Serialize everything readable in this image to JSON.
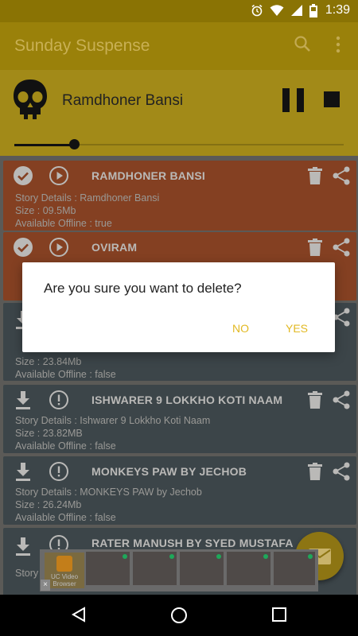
{
  "status_bar": {
    "clock": "1:39",
    "icons": [
      "alarm-icon",
      "wifi-icon",
      "signal-icon",
      "battery-icon"
    ]
  },
  "app_bar": {
    "title": "Sunday Suspense",
    "actions": [
      "search-icon",
      "overflow-menu-icon"
    ]
  },
  "player": {
    "track_title": "Ramdhoner Bansi",
    "progress_fraction": 0.18,
    "controls": [
      "pause-icon",
      "stop-icon"
    ]
  },
  "stories": [
    {
      "title": "RAMDHONER BANSI",
      "details": "Story Details : Ramdhoner Bansi",
      "size": "Size : 09.5Mb",
      "offline": "Available Offline : true",
      "downloaded": true
    },
    {
      "title": "OVIRAM",
      "details": "",
      "size": "",
      "offline": "",
      "downloaded": true
    },
    {
      "title": "",
      "details": "",
      "size": "Size : 23.84Mb",
      "offline": "Available Offline : false",
      "downloaded": false
    },
    {
      "title": "ISHWARER 9 LOKKHO KOTI NAAM",
      "details": "Story Details : Ishwarer 9 Lokkho Koti Naam",
      "size": "Size : 23.82MB",
      "offline": "Available Offline : false",
      "downloaded": false
    },
    {
      "title": "MONKEYS PAW BY JECHOB",
      "details": "Story Details : MONKEYS PAW by Jechob",
      "size": "Size : 26.24Mb",
      "offline": "Available Offline : false",
      "downloaded": false
    },
    {
      "title": "RATER MANUSH BY SYED MUSTAFA",
      "details": "",
      "size": "",
      "offline": "",
      "downloaded": false
    }
  ],
  "dialog": {
    "message": "Are you sure you want to delete?",
    "no_label": "NO",
    "yes_label": "YES"
  },
  "ad_banner": {
    "app_name": "UC Video Browser"
  },
  "colors": {
    "accent": "#f2c21a",
    "downloaded_card": "#844022",
    "pending_card": "#3c4549"
  }
}
